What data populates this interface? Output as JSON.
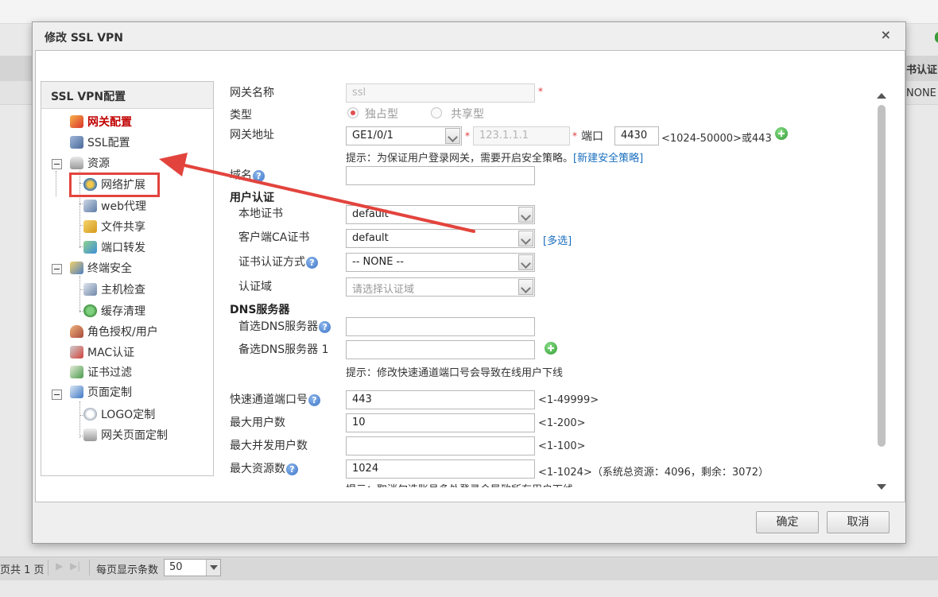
{
  "background": {
    "column_header": "书认证",
    "row_value": "NONE",
    "pager": {
      "pages_text": "页共 1 页",
      "first_btn": "▶",
      "last_btn": "▶|",
      "per_page_label": "每页显示条数",
      "per_page_value": "50"
    }
  },
  "dialog": {
    "title": "修改 SSL VPN",
    "close": "×",
    "ok_label": "确定",
    "cancel_label": "取消"
  },
  "tree": {
    "header": "SSL VPN配置",
    "items": [
      {
        "label": "网关配置",
        "icon": "gateway-config-icon",
        "active": true
      },
      {
        "label": "SSL配置",
        "icon": "ssl-config-icon"
      },
      {
        "label": "资源",
        "icon": "resource-db-icon"
      },
      {
        "label": "网络扩展",
        "icon": "network-extension-icon"
      },
      {
        "label": "web代理",
        "icon": "web-proxy-icon"
      },
      {
        "label": "文件共享",
        "icon": "file-share-icon"
      },
      {
        "label": "端口转发",
        "icon": "port-forward-icon"
      },
      {
        "label": "终端安全",
        "icon": "terminal-security-icon"
      },
      {
        "label": "主机检查",
        "icon": "host-check-icon"
      },
      {
        "label": "缓存清理",
        "icon": "cache-clean-icon"
      },
      {
        "label": "角色授权/用户",
        "icon": "role-user-icon"
      },
      {
        "label": "MAC认证",
        "icon": "mac-auth-icon"
      },
      {
        "label": "证书过滤",
        "icon": "cert-filter-icon"
      },
      {
        "label": "页面定制",
        "icon": "page-custom-icon"
      },
      {
        "label": "LOGO定制",
        "icon": "logo-custom-icon"
      },
      {
        "label": "网关页面定制",
        "icon": "gateway-page-icon"
      }
    ]
  },
  "form": {
    "gateway_name_label": "网关名称",
    "gateway_name_value": "ssl",
    "type_label": "类型",
    "type_options": [
      "独占型",
      "共享型"
    ],
    "type_selected": "独占型",
    "gateway_addr_label": "网关地址",
    "interface_value": "GE1/0/1",
    "ip_placeholder": "123.1.1.1",
    "port_label": "端口",
    "port_value": "4430",
    "port_range": "<1024-50000>或443",
    "gateway_hint_prefix": "提示：为保证用户登录网关，需要开启安全策略。",
    "gateway_hint_link": "[新建安全策略]",
    "domain_label": "域名",
    "user_auth_section": "用户认证",
    "local_cert_label": "本地证书",
    "local_cert_value": "default",
    "client_ca_label": "客户端CA证书",
    "client_ca_value": "default",
    "multi_select_link": "[多选]",
    "cert_auth_label": "证书认证方式",
    "cert_auth_value": "-- NONE --",
    "auth_domain_label": "认证域",
    "auth_domain_placeholder": "请选择认证域",
    "dns_section": "DNS服务器",
    "primary_dns_label": "首选DNS服务器",
    "secondary_dns_label": "备选DNS服务器 1",
    "dns_hint": "提示：修改快速通道端口号会导致在线用户下线",
    "fast_port_label": "快速通道端口号",
    "fast_port_value": "443",
    "fast_port_range": "<1-49999>",
    "max_users_label": "最大用户数",
    "max_users_value": "10",
    "max_users_range": "<1-200>",
    "max_concurrent_label": "最大并发用户数",
    "max_concurrent_range": "<1-100>",
    "max_resources_label": "最大资源数",
    "max_resources_value": "1024",
    "max_resources_range": "<1-1024>（系统总资源：4096，剩余：3072）",
    "cut_hint": "提示：取消勾选账号多处登录会导致所有用户下线",
    "help_glyph": "?"
  },
  "colors": {
    "annotation": "#e2443d",
    "active_item": "#c00000",
    "link": "#1a6fbf",
    "required": "#e03a3a"
  }
}
